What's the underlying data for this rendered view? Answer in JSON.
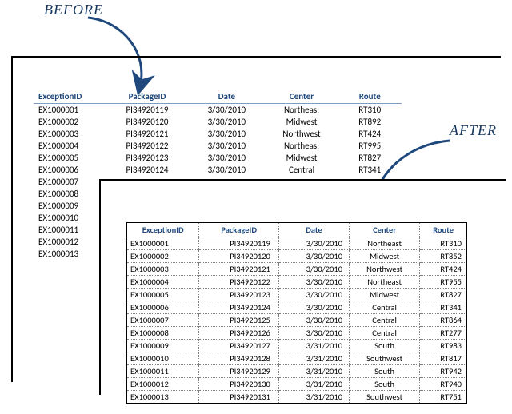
{
  "labels": {
    "before": "BEFORE",
    "after": "AFTER"
  },
  "headers": {
    "exception_id": "ExceptionID",
    "package_id": "PackageID",
    "date": "Date",
    "center": "Center",
    "route": "Route"
  },
  "before_rows": [
    {
      "id": "EX1000001",
      "pkg": "PI34920119",
      "date": "3/30/2010",
      "ctr": "Northeas:",
      "rte": "RT310"
    },
    {
      "id": "EX1000002",
      "pkg": "PI34920120",
      "date": "3/30/2010",
      "ctr": "Midwest",
      "rte": "RT892"
    },
    {
      "id": "EX1000003",
      "pkg": "PI34920121",
      "date": "3/30/2010",
      "ctr": "Northwest",
      "rte": "RT424"
    },
    {
      "id": "EX1000004",
      "pkg": "PI34920122",
      "date": "3/30/2010",
      "ctr": "Northeas:",
      "rte": "RT995"
    },
    {
      "id": "EX1000005",
      "pkg": "PI34920123",
      "date": "3/30/2010",
      "ctr": "Midwest",
      "rte": "RT827"
    },
    {
      "id": "EX1000006",
      "pkg": "PI34920124",
      "date": "3/30/2010",
      "ctr": "Central",
      "rte": "RT341"
    },
    {
      "id": "EX1000007",
      "pkg": "",
      "date": "",
      "ctr": "",
      "rte": ""
    },
    {
      "id": "EX1000008",
      "pkg": "",
      "date": "",
      "ctr": "",
      "rte": ""
    },
    {
      "id": "EX1000009",
      "pkg": "",
      "date": "",
      "ctr": "",
      "rte": ""
    },
    {
      "id": "EX1000010",
      "pkg": "",
      "date": "",
      "ctr": "",
      "rte": ""
    },
    {
      "id": "EX1000011",
      "pkg": "",
      "date": "",
      "ctr": "",
      "rte": ""
    },
    {
      "id": "EX1000012",
      "pkg": "",
      "date": "",
      "ctr": "",
      "rte": ""
    },
    {
      "id": "EX1000013",
      "pkg": "",
      "date": "",
      "ctr": "",
      "rte": ""
    }
  ],
  "after_rows": [
    {
      "id": "EX1000001",
      "pkg": "PI34920119",
      "date": "3/30/2010",
      "ctr": "Northeast",
      "rte": "RT310"
    },
    {
      "id": "EX1000002",
      "pkg": "PI34920120",
      "date": "3/30/2010",
      "ctr": "Midwest",
      "rte": "RT852"
    },
    {
      "id": "EX1000003",
      "pkg": "PI34920121",
      "date": "3/30/2010",
      "ctr": "Northwest",
      "rte": "RT424"
    },
    {
      "id": "EX1000004",
      "pkg": "PI34920122",
      "date": "3/30/2010",
      "ctr": "Northeast",
      "rte": "RT955"
    },
    {
      "id": "EX1000005",
      "pkg": "PI34920123",
      "date": "3/30/2010",
      "ctr": "Midwest",
      "rte": "RT827"
    },
    {
      "id": "EX1000006",
      "pkg": "PI34920124",
      "date": "3/30/2010",
      "ctr": "Central",
      "rte": "RT341"
    },
    {
      "id": "EX1000007",
      "pkg": "PI34920125",
      "date": "3/30/2010",
      "ctr": "Central",
      "rte": "RT864"
    },
    {
      "id": "EX1000008",
      "pkg": "PI34920126",
      "date": "3/30/2010",
      "ctr": "Central",
      "rte": "RT277"
    },
    {
      "id": "EX1000009",
      "pkg": "PI34920127",
      "date": "3/31/2010",
      "ctr": "South",
      "rte": "RT983"
    },
    {
      "id": "EX1000010",
      "pkg": "PI34920128",
      "date": "3/31/2010",
      "ctr": "Southwest",
      "rte": "RT817"
    },
    {
      "id": "EX1000011",
      "pkg": "PI34920129",
      "date": "3/31/2010",
      "ctr": "South",
      "rte": "RT942"
    },
    {
      "id": "EX1000012",
      "pkg": "PI34920130",
      "date": "3/31/2010",
      "ctr": "South",
      "rte": "RT940"
    },
    {
      "id": "EX1000013",
      "pkg": "PI34920131",
      "date": "3/31/2010",
      "ctr": "Southwest",
      "rte": "RT751"
    }
  ],
  "colors": {
    "arrow": "#1f497d",
    "header_text": "#1f497d"
  }
}
